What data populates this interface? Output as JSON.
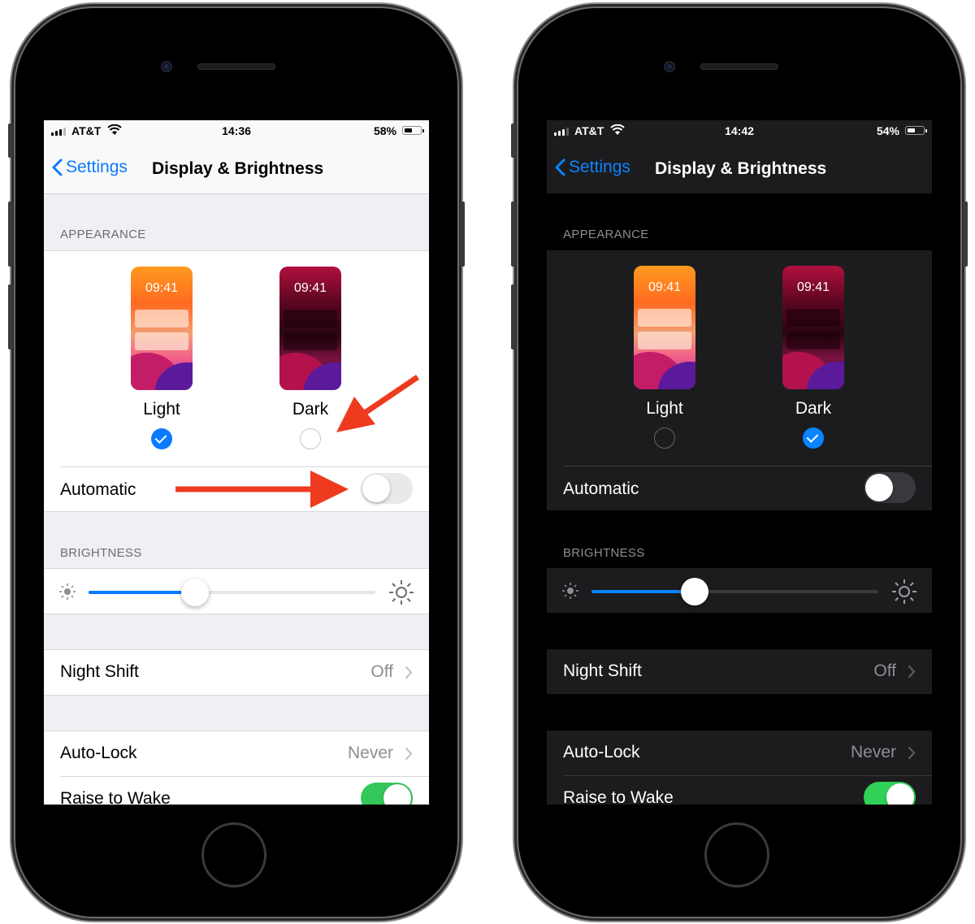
{
  "colors": {
    "accent_blue": "#0a7aff",
    "toggle_green": "#34c759",
    "annotation_red": "#ee3b1f"
  },
  "phones": [
    {
      "theme": "light",
      "status": {
        "carrier": "AT&T",
        "time": "14:36",
        "battery_pct_text": "58%",
        "battery_level": 0.58
      },
      "nav": {
        "back_label": "Settings",
        "title": "Display & Brightness"
      },
      "appearance": {
        "header": "APPEARANCE",
        "light": {
          "preview_time": "09:41",
          "label": "Light",
          "selected": true
        },
        "dark": {
          "preview_time": "09:41",
          "label": "Dark",
          "selected": false
        }
      },
      "automatic": {
        "label": "Automatic",
        "on": false
      },
      "brightness": {
        "header": "BRIGHTNESS",
        "level": 0.37
      },
      "night_shift": {
        "label": "Night Shift",
        "value": "Off"
      },
      "auto_lock": {
        "label": "Auto-Lock",
        "value": "Never"
      },
      "raise_to_wake": {
        "label": "Raise to Wake",
        "on": true
      }
    },
    {
      "theme": "dark",
      "status": {
        "carrier": "AT&T",
        "time": "14:42",
        "battery_pct_text": "54%",
        "battery_level": 0.54
      },
      "nav": {
        "back_label": "Settings",
        "title": "Display & Brightness"
      },
      "appearance": {
        "header": "APPEARANCE",
        "light": {
          "preview_time": "09:41",
          "label": "Light",
          "selected": false
        },
        "dark": {
          "preview_time": "09:41",
          "label": "Dark",
          "selected": true
        }
      },
      "automatic": {
        "label": "Automatic",
        "on": false
      },
      "brightness": {
        "header": "BRIGHTNESS",
        "level": 0.36
      },
      "night_shift": {
        "label": "Night Shift",
        "value": "Off"
      },
      "auto_lock": {
        "label": "Auto-Lock",
        "value": "Never"
      },
      "raise_to_wake": {
        "label": "Raise to Wake",
        "on": true
      }
    }
  ]
}
